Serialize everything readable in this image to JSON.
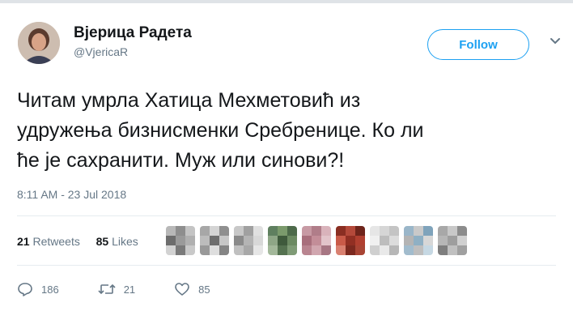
{
  "user": {
    "display_name": "Вјерица Радета",
    "handle": "@VjericaR"
  },
  "follow_label": "Follow",
  "tweet": {
    "lines": [
      "Читам умрла Хатица Мехметовић из",
      "удружења бизнисменки Сребренице. Ко ли",
      "ће је сахранити. Муж или синови?!"
    ],
    "timestamp": "8:11 AM - 23 Jul 2018"
  },
  "stats": {
    "retweets_count": "21",
    "retweets_label": "Retweets",
    "likes_count": "85",
    "likes_label": "Likes"
  },
  "actions": {
    "reply_count": "186",
    "retweet_count": "21",
    "like_count": "85"
  },
  "colors": {
    "accent": "#1da1f2",
    "muted": "#657786",
    "text": "#14171a"
  },
  "icons": [
    "chevron-down-icon",
    "reply-icon",
    "retweet-icon",
    "heart-icon"
  ]
}
